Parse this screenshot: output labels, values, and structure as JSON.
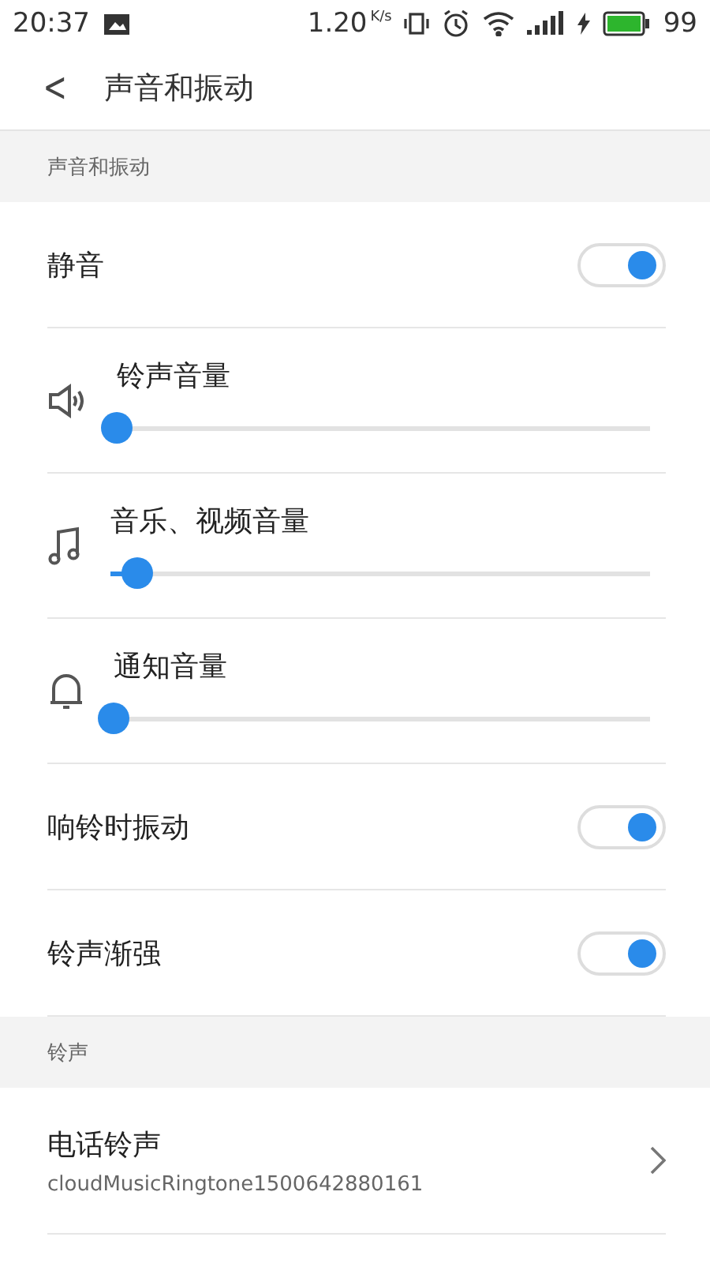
{
  "status_bar": {
    "time": "20:37",
    "speed": "1.20",
    "speed_unit": "K/s",
    "battery": "99"
  },
  "header": {
    "back": "<",
    "title": "声音和振动"
  },
  "sections": [
    {
      "title": "声音和振动",
      "items": [
        {
          "kind": "toggle",
          "label": "静音",
          "on": true
        },
        {
          "kind": "slider",
          "label": "铃声音量",
          "level": 0
        },
        {
          "kind": "slider",
          "label": "音乐、视频音量",
          "level": 0.05
        },
        {
          "kind": "slider",
          "label": "通知音量",
          "level": 0
        },
        {
          "kind": "toggle",
          "label": "响铃时振动",
          "on": true
        },
        {
          "kind": "toggle",
          "label": "铃声渐强",
          "on": true
        }
      ]
    },
    {
      "title": "铃声",
      "items": [
        {
          "kind": "link",
          "label": "电话铃声",
          "value": "cloudMusicRingtone1500642880161"
        }
      ]
    }
  ]
}
